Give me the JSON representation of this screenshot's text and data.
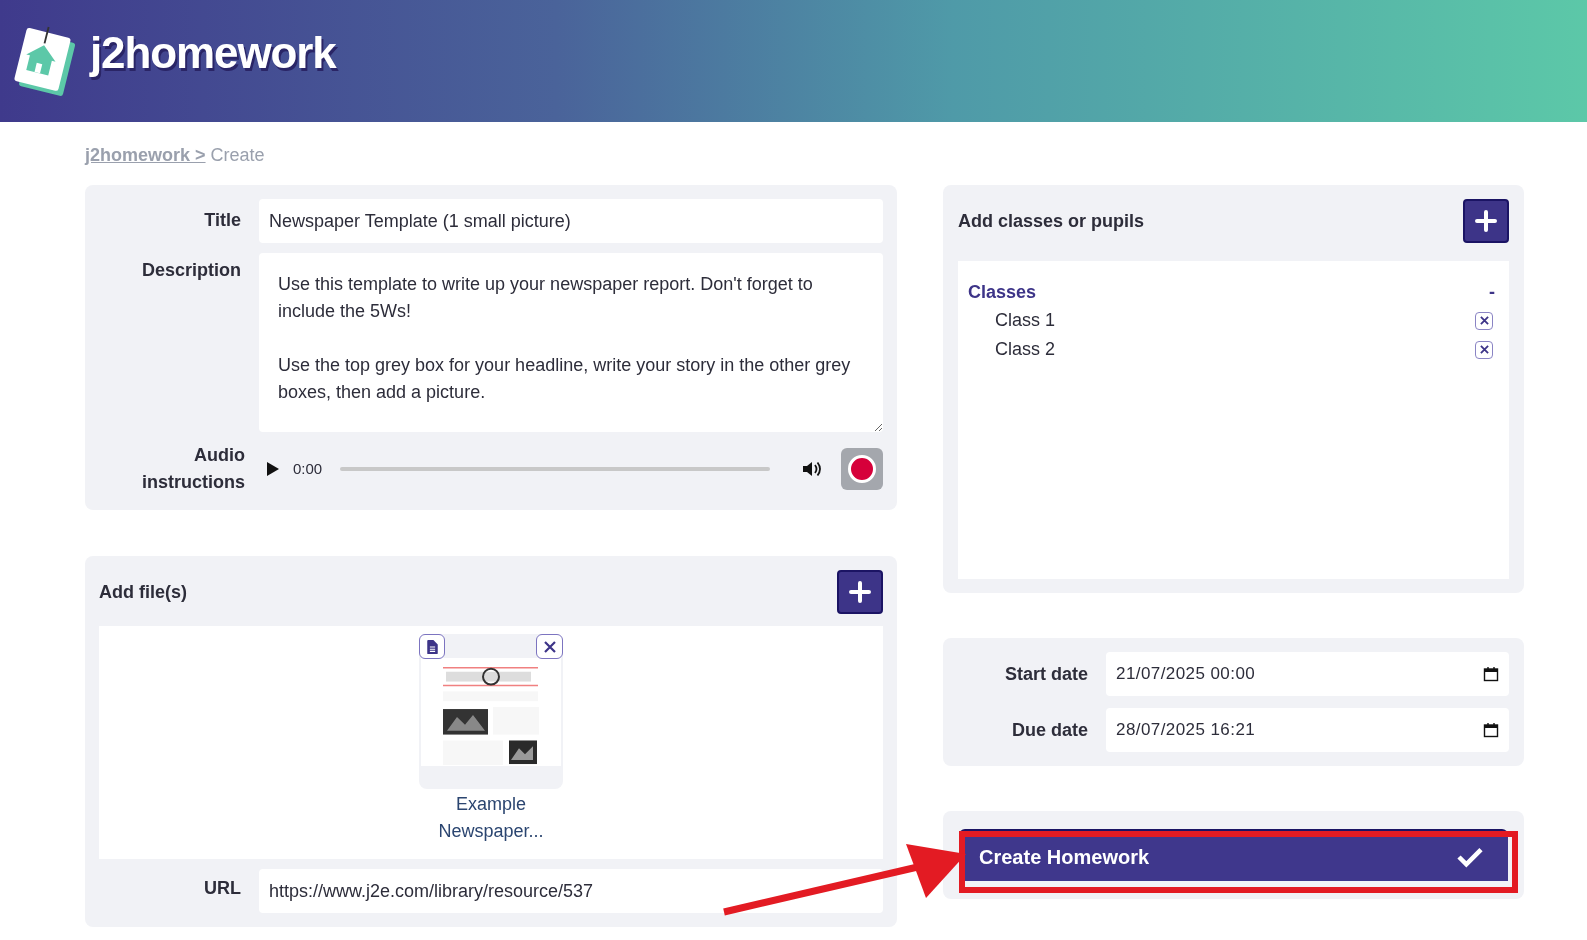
{
  "header": {
    "logo_text": "j2homework"
  },
  "breadcrumb": {
    "link": "j2homework >",
    "current": "Create"
  },
  "details": {
    "title_label": "Title",
    "title_value": "Newspaper Template (1 small picture)",
    "description_label": "Description",
    "description_value": "Use this template to write up your newspaper report. Don't forget to include the 5Ws!\n\nUse the top grey box for your headline, write your story in the other grey boxes, then add a picture.",
    "audio_label": "Audio instructions",
    "audio": {
      "time": "0:00"
    }
  },
  "files": {
    "heading": "Add file(s)",
    "items": [
      {
        "name": "Example Newspaper...",
        "kind": "picture"
      }
    ],
    "url_label": "URL",
    "url_value": "https://www.j2e.com/library/resource/537"
  },
  "recipients": {
    "heading": "Add classes or pupils",
    "groups": [
      {
        "name": "Classes",
        "toggle": "-",
        "children": [
          {
            "name": "Class 1"
          },
          {
            "name": "Class 2"
          }
        ]
      }
    ]
  },
  "dates": [
    {
      "label": "Start date",
      "value": "21/07/2025 00:00"
    },
    {
      "label": "Due date",
      "value": "28/07/2025 16:21"
    }
  ],
  "submit": {
    "label": "Create Homework",
    "highlighted": true
  }
}
